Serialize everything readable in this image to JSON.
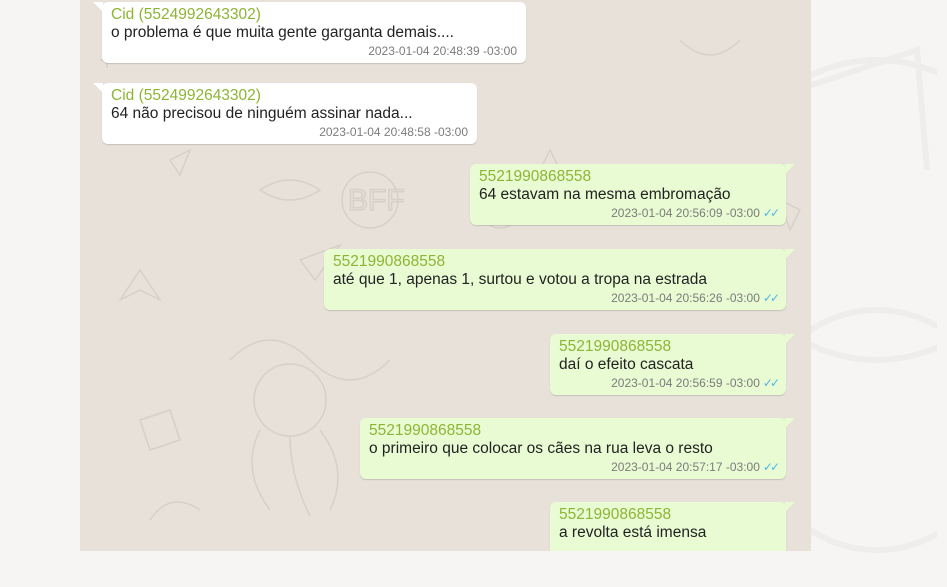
{
  "messages": [
    {
      "sender": "Cid (5524992643302)",
      "text": "o problema é que muita gente garganta demais....",
      "time": "2023-01-04 20:48:39 -03:00",
      "direction": "in"
    },
    {
      "sender": "Cid (5524992643302)",
      "text": "64 não precisou de ninguém assinar nada...",
      "time": "2023-01-04 20:48:58 -03:00",
      "direction": "in"
    },
    {
      "sender": "5521990868558",
      "text": "64 estavam na mesma embromação",
      "time": "2023-01-04 20:56:09 -03:00",
      "direction": "out",
      "status_icon": "double-check-icon"
    },
    {
      "sender": "5521990868558",
      "text": "até que 1, apenas 1, surtou e votou a tropa na estrada",
      "time": "2023-01-04 20:56:26 -03:00",
      "direction": "out",
      "status_icon": "double-check-icon"
    },
    {
      "sender": "5521990868558",
      "text": "daí o efeito cascata",
      "time": "2023-01-04 20:56:59 -03:00",
      "direction": "out",
      "status_icon": "double-check-icon"
    },
    {
      "sender": "5521990868558",
      "text": "o primeiro que colocar os cães na rua leva o resto",
      "time": "2023-01-04 20:57:17 -03:00",
      "direction": "out",
      "status_icon": "double-check-icon"
    },
    {
      "sender": "5521990868558",
      "text": "a revolta está imensa",
      "time": "",
      "direction": "out"
    }
  ],
  "colors": {
    "incoming_bubble": "#ffffff",
    "outgoing_bubble": "#e8fbd3",
    "sender_name": "#8db534",
    "read_ticks": "#4fb6ec",
    "chat_background": "#e7e1d9"
  }
}
